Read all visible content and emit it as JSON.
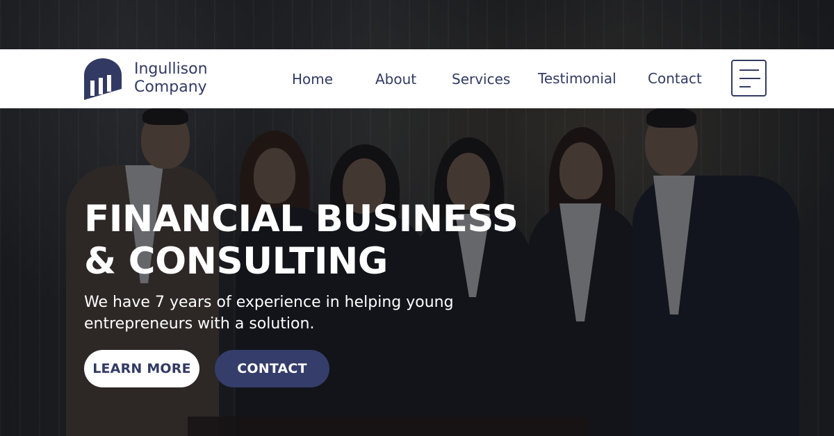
{
  "brand": {
    "name_line1": "Ingullison",
    "name_line2": "Company",
    "color": "#323a63",
    "logo_icon": "building-logo-icon"
  },
  "nav": {
    "items": [
      {
        "label": "Home"
      },
      {
        "label": "About"
      },
      {
        "label": "Services"
      },
      {
        "label": "Testimonial"
      },
      {
        "label": "Contact"
      }
    ],
    "menu_icon": "hamburger-menu-icon"
  },
  "hero": {
    "title_line1": "FINANCIAL BUSINESS",
    "title_line2": "& CONSULTING",
    "subtitle_line1": "We have 7 years of experience in helping young",
    "subtitle_line2": "entrepreneurs with a solution.",
    "learn_more_label": "LEARN MORE",
    "contact_label": "CONTACT",
    "primary_button_color": "#353d6a"
  }
}
